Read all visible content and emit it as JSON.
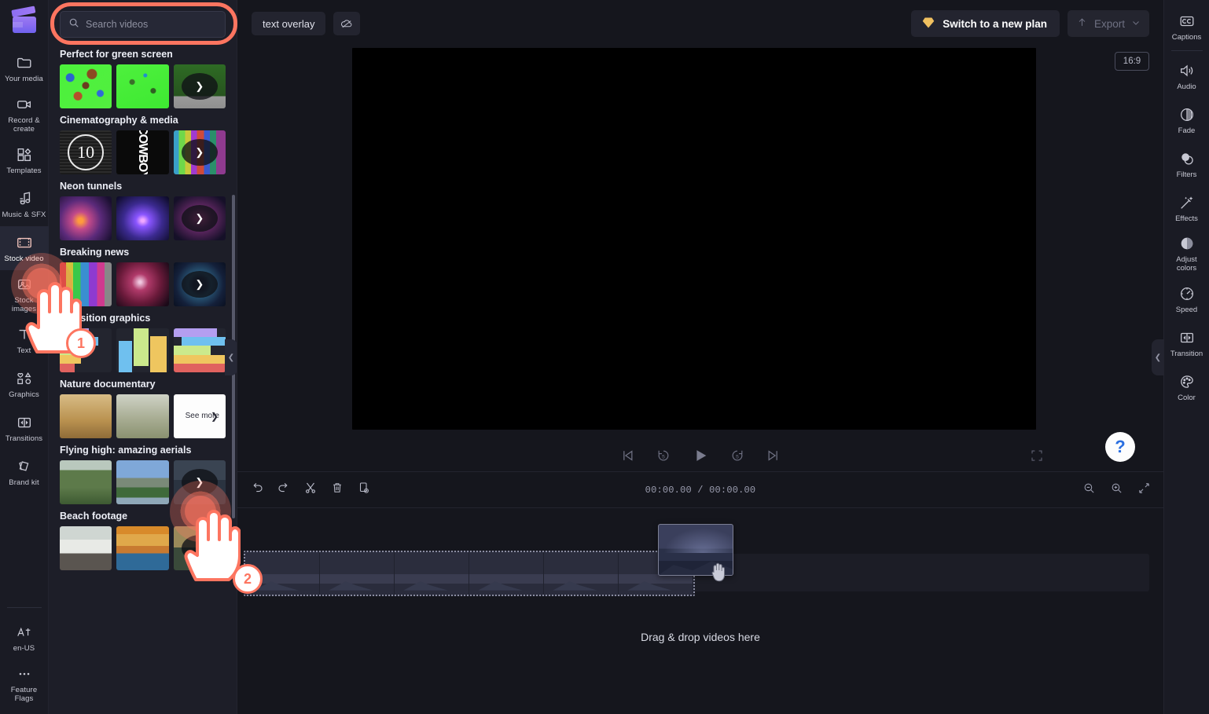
{
  "app": {
    "logo_name": "clipchamp-logo",
    "accent": "#8c6df0",
    "annotation_color": "#fd7560"
  },
  "left_rail": {
    "items": [
      {
        "label": "Your media",
        "icon": "folder-icon",
        "active": false
      },
      {
        "label": "Record & create",
        "icon": "video-camera-icon",
        "active": false
      },
      {
        "label": "Templates",
        "icon": "templates-icon",
        "active": false
      },
      {
        "label": "Music & SFX",
        "icon": "music-note-icon",
        "active": false
      },
      {
        "label": "Stock video",
        "icon": "film-strip-icon",
        "active": true
      },
      {
        "label": "Stock images",
        "icon": "image-icon",
        "active": false
      },
      {
        "label": "Text",
        "icon": "text-icon",
        "active": false
      },
      {
        "label": "Graphics",
        "icon": "shapes-icon",
        "active": false
      },
      {
        "label": "Transitions",
        "icon": "transitions-icon",
        "active": false
      },
      {
        "label": "Brand kit",
        "icon": "brand-kit-icon",
        "active": false
      }
    ],
    "bottom_items": [
      {
        "label": "en-US",
        "icon": "language-icon"
      },
      {
        "label": "Feature Flags",
        "icon": "ellipsis-icon"
      }
    ]
  },
  "stock_panel": {
    "search": {
      "placeholder": "Search videos",
      "value": "",
      "icon": "search-icon"
    },
    "collapse_icon": "chevron-left-icon",
    "see_more_label": "See more",
    "categories": [
      {
        "title": "Perfect for green screen",
        "thumbs": [
          "t-green1",
          "t-green2",
          "t-green3"
        ],
        "last": "more"
      },
      {
        "title": "Cinematography & media",
        "thumbs": [
          "t-ten",
          "t-cowboy",
          "t-glitch"
        ],
        "last": "more"
      },
      {
        "title": "Neon tunnels",
        "thumbs": [
          "t-neon1",
          "t-neon2",
          "t-neon3"
        ],
        "last": "more"
      },
      {
        "title": "Breaking news",
        "thumbs": [
          "t-news1",
          "t-news2",
          "t-news3"
        ],
        "last": "more"
      },
      {
        "title": "Transition graphics",
        "thumbs": [
          "t-tr1",
          "t-tr2",
          "t-tr3"
        ],
        "last": "none"
      },
      {
        "title": "Nature documentary",
        "thumbs": [
          "t-nat1",
          "t-nat2",
          "seemore"
        ],
        "last": "seemore"
      },
      {
        "title": "Flying high: amazing aerials",
        "thumbs": [
          "t-fly1",
          "t-fly2",
          "t-fly3"
        ],
        "last": "more"
      },
      {
        "title": "Beach footage",
        "thumbs": [
          "t-beach1",
          "t-beach2",
          "t-beach3"
        ],
        "last": "more"
      }
    ]
  },
  "topbar": {
    "project_chip": "text overlay",
    "cloud_off_icon": "cloud-offline-icon",
    "plan_button": "Switch to a new plan",
    "plan_icon": "diamond-icon",
    "export_button": "Export",
    "export_icon": "upload-icon",
    "export_caret": "chevron-down-icon"
  },
  "stage": {
    "aspect_ratio": "16:9",
    "help_glyph": "?",
    "transport": [
      {
        "name": "skip-to-start-icon"
      },
      {
        "name": "rewind-5-icon",
        "label": "5"
      },
      {
        "name": "play-icon"
      },
      {
        "name": "forward-5-icon",
        "label": "5"
      },
      {
        "name": "skip-to-end-icon"
      }
    ],
    "fullscreen_icon": "fullscreen-icon"
  },
  "timeline": {
    "tools": [
      {
        "name": "undo-icon"
      },
      {
        "name": "redo-icon"
      },
      {
        "name": "split-icon"
      },
      {
        "name": "delete-icon"
      },
      {
        "name": "duplicate-icon"
      }
    ],
    "current_time": "00:00.00",
    "time_separator": "/",
    "total_time": "00:00.00",
    "right_tools": [
      {
        "name": "zoom-out-icon"
      },
      {
        "name": "zoom-in-icon"
      },
      {
        "name": "fit-to-screen-icon"
      }
    ],
    "drop_hint": "Drag & drop videos here"
  },
  "right_rail": {
    "top": {
      "label": "Captions",
      "icon": "closed-captions-icon"
    },
    "items": [
      {
        "label": "Audio",
        "icon": "speaker-icon"
      },
      {
        "label": "Fade",
        "icon": "fade-icon"
      },
      {
        "label": "Filters",
        "icon": "filters-icon"
      },
      {
        "label": "Effects",
        "icon": "magic-wand-icon"
      },
      {
        "label": "Adjust colors",
        "icon": "contrast-icon"
      },
      {
        "label": "Speed",
        "icon": "speedometer-icon"
      },
      {
        "label": "Transition",
        "icon": "transition-icon"
      },
      {
        "label": "Color",
        "icon": "palette-icon"
      }
    ],
    "collapse_icon": "chevron-left-icon"
  },
  "annotations": {
    "steps": [
      {
        "number": "1",
        "target": "sidebar-item-stock-video"
      },
      {
        "number": "2",
        "target": "see-more-button"
      }
    ]
  }
}
